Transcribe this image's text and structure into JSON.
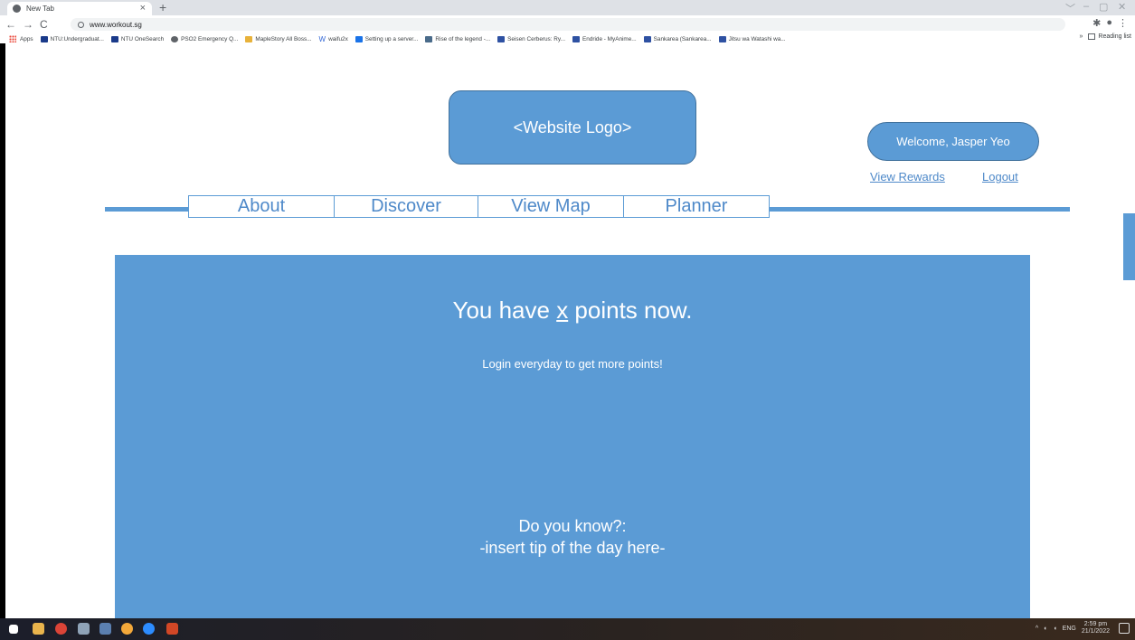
{
  "browser": {
    "tab_title": "New Tab",
    "tab_close": "×",
    "new_tab": "+",
    "window_controls": [
      "﹀",
      "–",
      "▢",
      "✕"
    ],
    "url": "www.workout.sg",
    "bookmarks": [
      {
        "label": "Apps",
        "icon": "apps-grid-icon"
      },
      {
        "label": "NTU:Undergraduat...",
        "icon": "ntu-icon"
      },
      {
        "label": "NTU OneSearch",
        "icon": "ntu-icon"
      },
      {
        "label": "PSO2 Emergency Q...",
        "icon": "globe-icon"
      },
      {
        "label": "MapleStory All Boss...",
        "icon": "maple-icon"
      },
      {
        "label": "waifu2x",
        "icon": "w-icon"
      },
      {
        "label": "Setting up a server...",
        "icon": "r-icon"
      },
      {
        "label": "Rise of the legend -...",
        "icon": "game-icon"
      },
      {
        "label": "Seisen Cerberus: Ry...",
        "icon": "mal-icon"
      },
      {
        "label": "Endride - MyAnime...",
        "icon": "mal-icon"
      },
      {
        "label": "Sankarea (Sankarea...",
        "icon": "mal-icon"
      },
      {
        "label": "Jitsu wa Watashi wa...",
        "icon": "mal-icon"
      }
    ],
    "more_bookmarks": "»",
    "reading_list": "Reading list"
  },
  "site": {
    "logo_text": "<Website Logo>",
    "welcome_text": "Welcome, Jasper Yeo",
    "view_rewards": "View Rewards",
    "logout": "Logout",
    "nav": [
      "About",
      "Discover",
      "View Map",
      "Planner"
    ]
  },
  "rewards": {
    "points_prefix": "You have ",
    "points_value": "x",
    "points_suffix": " points now.",
    "hint": "Login everyday to get more points!",
    "tip_question": "Do you know?:",
    "tip_text": "-insert tip of the day here-"
  },
  "taskbar": {
    "language": "ENG",
    "time": "2:59 pm",
    "date": "21/1/2022"
  },
  "colors": {
    "accent": "#5b9bd5",
    "link": "#4e89c9"
  }
}
